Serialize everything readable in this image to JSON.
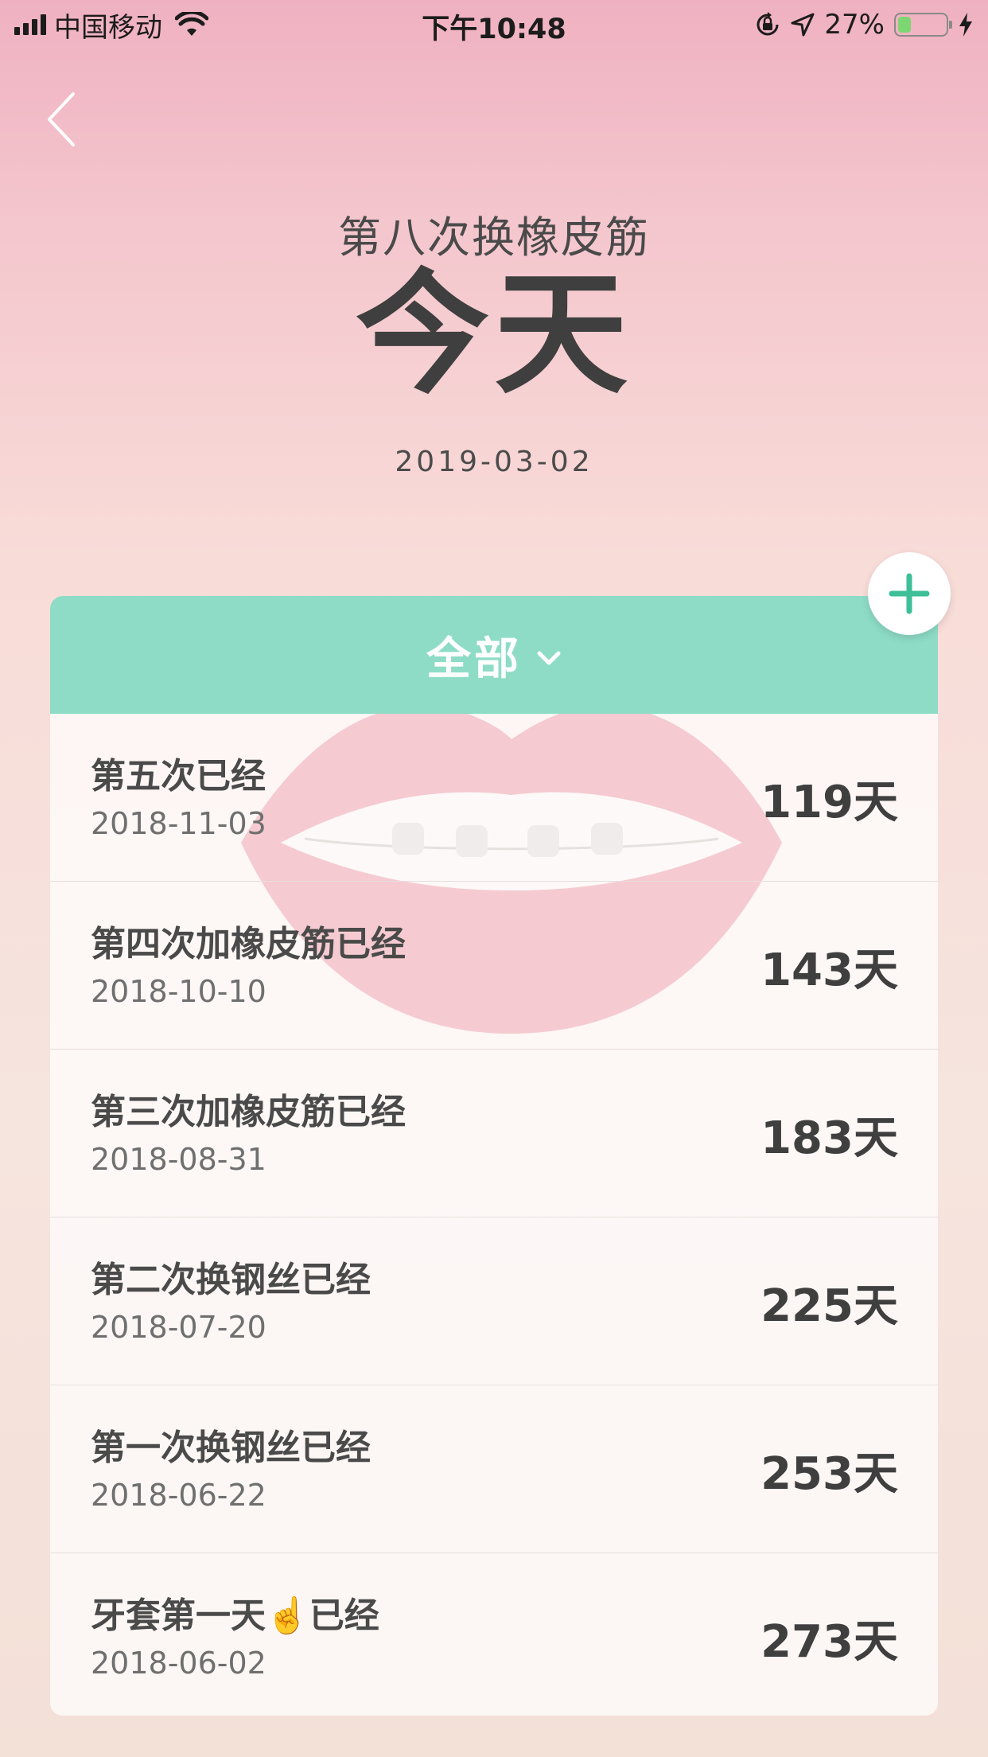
{
  "status_bar": {
    "carrier": "中国移动",
    "time": "下午10:48",
    "battery_percent": "27%",
    "battery_level": 0.27,
    "icons": [
      "signal-icon",
      "wifi-icon",
      "rotation-lock-icon",
      "location-icon",
      "battery-icon",
      "charging-icon"
    ]
  },
  "header": {
    "subtitle": "第八次换橡皮筋",
    "hero": "今天",
    "date": "2019-03-02"
  },
  "filter": {
    "label": "全部"
  },
  "colors": {
    "accent": "#8edcc6",
    "plus_icon": "#3dbf98"
  },
  "events": [
    {
      "title": "第五次已经",
      "date": "2018-11-03",
      "days": "119天"
    },
    {
      "title": "第四次加橡皮筋已经",
      "date": "2018-10-10",
      "days": "143天"
    },
    {
      "title": "第三次加橡皮筋已经",
      "date": "2018-08-31",
      "days": "183天"
    },
    {
      "title": "第二次换钢丝已经",
      "date": "2018-07-20",
      "days": "225天"
    },
    {
      "title": "第一次换钢丝已经",
      "date": "2018-06-22",
      "days": "253天"
    },
    {
      "title": "牙套第一天☝️已经",
      "date": "2018-06-02",
      "days": "273天"
    }
  ]
}
